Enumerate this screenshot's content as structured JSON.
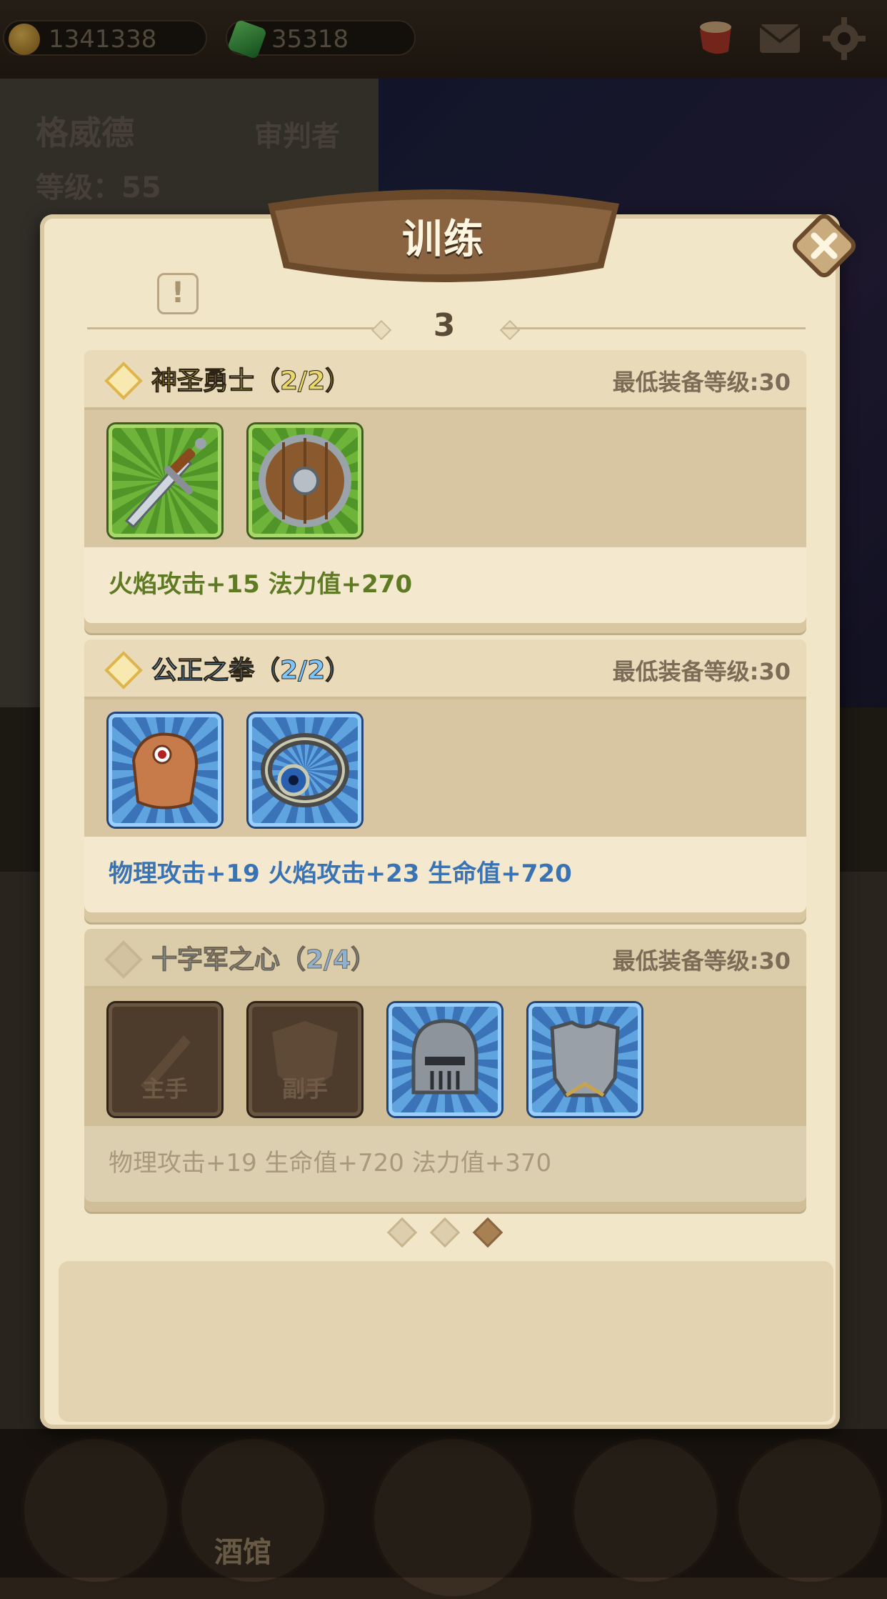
{
  "resources": {
    "gold": "1341338",
    "gems": "35318"
  },
  "hero": {
    "name": "格威德",
    "class": "审判者",
    "level_text": "等级：55"
  },
  "nav": {
    "tavern_label": "酒馆"
  },
  "modal": {
    "title": "训练",
    "page_level": "3",
    "sets": [
      {
        "name": "神圣勇士（2/2）",
        "requirement": "最低装备等级:30",
        "bonus": "火焰攻击+15  法力值+270",
        "active": true,
        "name_color": "#e8d96a",
        "bonus_color": "#5e7a22",
        "items": [
          {
            "icon": "sword-icon",
            "rarity": "green"
          },
          {
            "icon": "round-shield-icon",
            "rarity": "green"
          }
        ]
      },
      {
        "name": "公正之拳（2/2）",
        "requirement": "最低装备等级:30",
        "bonus": "物理攻击+19  火焰攻击+23  生命值+720",
        "active": true,
        "name_color": "#7ec4ff",
        "bonus_color": "#3a73b3",
        "items": [
          {
            "icon": "gauntlet-icon",
            "rarity": "blue"
          },
          {
            "icon": "eye-ring-icon",
            "rarity": "blue"
          }
        ]
      },
      {
        "name": "十字军之心（2/4）",
        "requirement": "最低装备等级:30",
        "bonus": "物理攻击+19  生命值+720  法力值+370",
        "active": false,
        "name_color": "#8fb1cf",
        "bonus_color": "#a8987c",
        "items": [
          {
            "icon": "main-hand-slot-icon",
            "rarity": "empty",
            "label": "主手"
          },
          {
            "icon": "off-hand-slot-icon",
            "rarity": "empty",
            "label": "副手"
          },
          {
            "icon": "helmet-icon",
            "rarity": "blue"
          },
          {
            "icon": "chest-armor-icon",
            "rarity": "blue"
          }
        ]
      }
    ],
    "pager": {
      "total": 3,
      "current": 3
    }
  },
  "colors": {
    "parchment": "#f2e6c9",
    "banner": "#6b4a2c",
    "gold_accent": "#e0b44c"
  }
}
